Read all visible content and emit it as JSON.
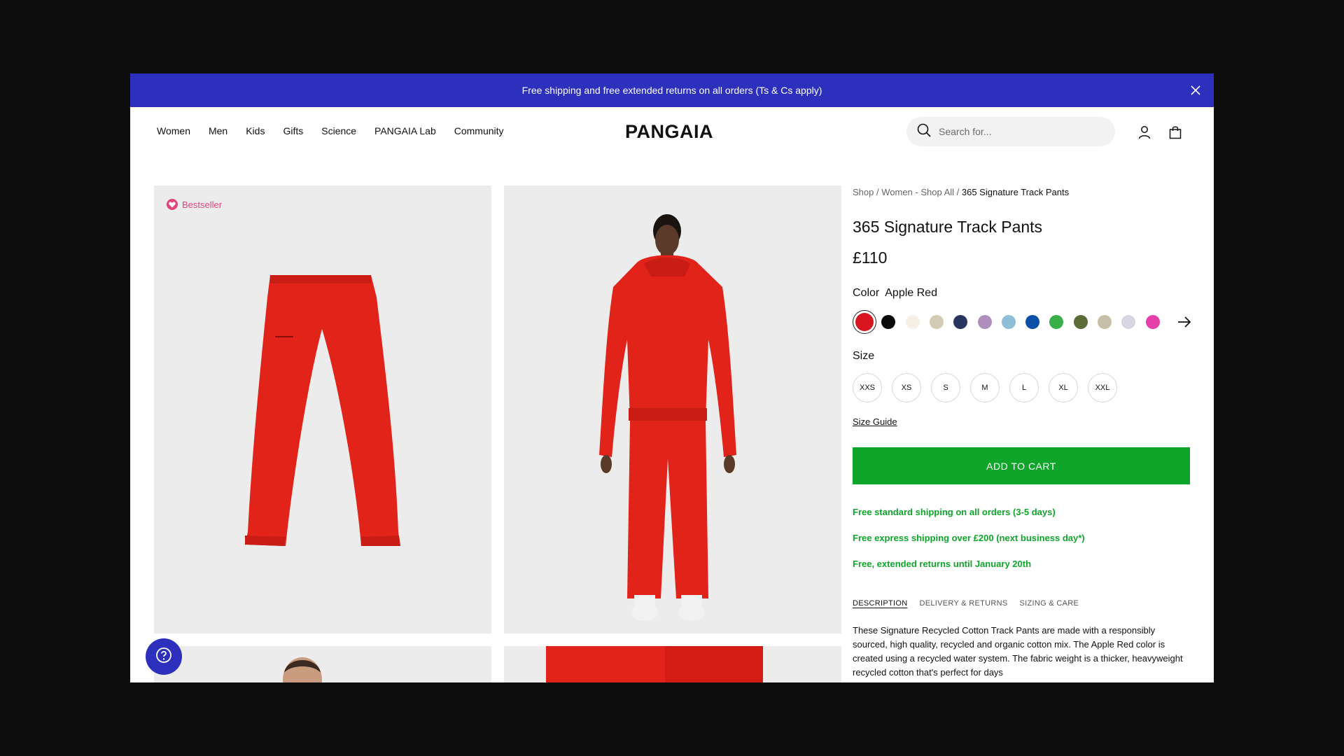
{
  "promo": {
    "text": "Free shipping and free extended returns on all orders (Ts & Cs apply)"
  },
  "header": {
    "nav": [
      "Women",
      "Men",
      "Kids",
      "Gifts",
      "Science",
      "PANGAIA Lab",
      "Community"
    ],
    "logo": "PANGAIA",
    "search_placeholder": "Search for..."
  },
  "gallery": {
    "badge": "Bestseller"
  },
  "product": {
    "breadcrumbs": [
      "Shop",
      "Women - Shop All",
      "365 Signature Track Pants"
    ],
    "title": "365 Signature Track Pants",
    "price": "£110",
    "color_label": "Color",
    "color_value": "Apple Red",
    "swatches": [
      "#d8161f",
      "#0a0a0a",
      "#f4f1e4",
      "#d4cbb5",
      "#28355e",
      "#b18fbd",
      "#8ebfd6",
      "#0b4fa6",
      "#3aae49",
      "#5d6b3a",
      "#c8bfa9",
      "#d6d6e2",
      "#e440a7"
    ],
    "size_label": "Size",
    "sizes": [
      "XXS",
      "XS",
      "S",
      "M",
      "L",
      "XL",
      "XXL"
    ],
    "size_guide": "Size Guide",
    "add_to_cart": "ADD TO CART",
    "perks": [
      "Free standard shipping on all orders (3-5 days)",
      "Free express shipping over £200 (next business day*)",
      "Free, extended returns until January 20th"
    ],
    "tabs": [
      "DESCRIPTION",
      "DELIVERY & RETURNS",
      "SIZING & CARE"
    ],
    "description": "These Signature Recycled Cotton Track Pants are made with a responsibly sourced, high quality, recycled and organic cotton mix. The Apple Red color is created using a recycled water system. The fabric weight is a thicker, heavyweight recycled cotton that's perfect for days"
  },
  "colors": {
    "brand_blue": "#2d2fbd",
    "cta_green": "#0ea52a",
    "product_red": "#e2231a",
    "bestseller_pink": "#e2457e"
  }
}
